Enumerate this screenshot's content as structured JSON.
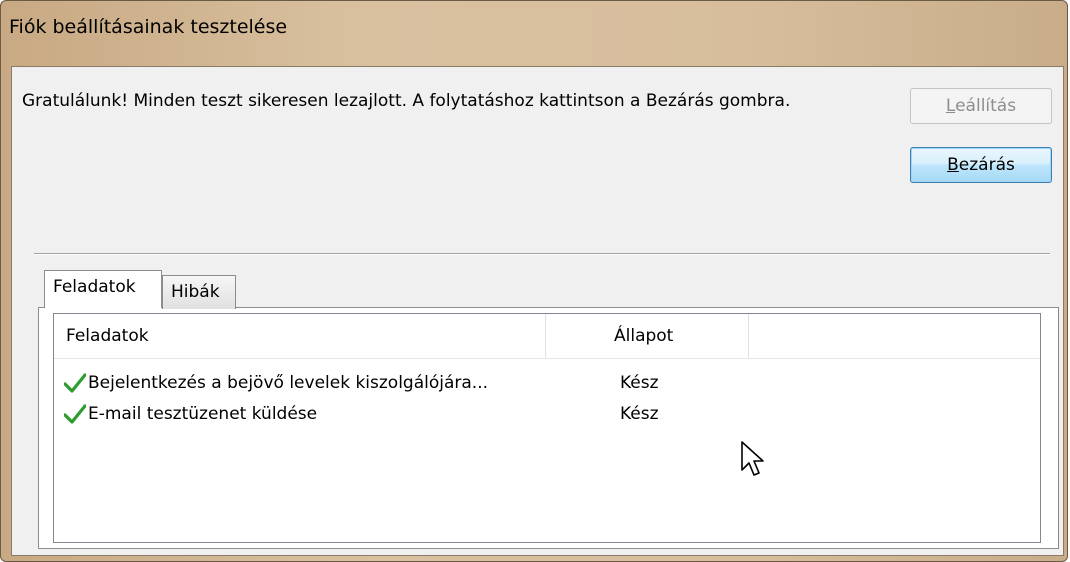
{
  "window": {
    "title": "Fiók beállításainak tesztelése"
  },
  "message": "Gratulálunk! Minden teszt sikeresen lezajlott. A folytatáshoz kattintson a Bezárás gombra.",
  "buttons": {
    "stop": {
      "mnemonic": "L",
      "rest": "eállítás",
      "enabled": false
    },
    "close": {
      "mnemonic": "B",
      "rest": "ezárás",
      "enabled": true
    }
  },
  "tabs": [
    {
      "label": "Feladatok",
      "active": true
    },
    {
      "label": "Hibák",
      "active": false
    }
  ],
  "list": {
    "columns": [
      "Feladatok",
      "Állapot"
    ],
    "rows": [
      {
        "icon": "check-icon",
        "task": "Bejelentkezés a bejövő levelek kiszolgálójára...",
        "status": "Kész"
      },
      {
        "icon": "check-icon",
        "task": "E-mail tesztüzenet küldése",
        "status": "Kész"
      }
    ]
  },
  "colors": {
    "frame": "#d7bd9c",
    "check": "#2e9c2e",
    "default_button_border": "#3c7fb1"
  }
}
